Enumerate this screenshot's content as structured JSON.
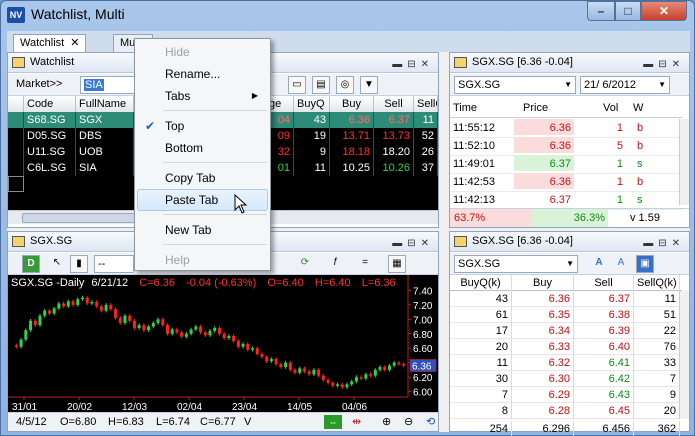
{
  "window": {
    "title": "Watchlist, Multi",
    "logo": "NV"
  },
  "tabs": [
    {
      "label": "Watchlist"
    },
    {
      "label": "Multi"
    }
  ],
  "watchlist": {
    "title": "Watchlist",
    "market_label": "Market>>",
    "market_value": "SIA",
    "columns": [
      "Code",
      "FullName",
      "ge",
      "BuyQ",
      "Buy",
      "Sell",
      "SellQ"
    ],
    "rows": [
      {
        "code": "S68.SG",
        "name": "SGX",
        "chg": "04",
        "buyq": "43",
        "buy": "6.36",
        "sell": "6.37",
        "sellq": "11",
        "selected": true
      },
      {
        "code": "D05.SG",
        "name": "DBS",
        "chg": "09",
        "buyq": "19",
        "buy": "13.71",
        "sell": "13.73",
        "sellq": "52"
      },
      {
        "code": "U11.SG",
        "name": "UOB",
        "chg": "32",
        "buyq": "9",
        "buy": "18.18",
        "sell": "18.20",
        "sellq": "26"
      },
      {
        "code": "C6L.SG",
        "name": "SIA",
        "chg": "01",
        "buyq": "11",
        "buy": "10.25",
        "sell": "10.26",
        "sellq": "37"
      }
    ]
  },
  "time_trades": {
    "title": "SGX.SG [6.36 -0.04]",
    "symbol": "SGX.SG",
    "date": "21/ 6/2012",
    "columns": [
      "Time",
      "Price",
      "Vol",
      "W"
    ],
    "rows": [
      {
        "time": "11:55:12",
        "price": "6.36",
        "vol": "1",
        "w": "b",
        "tone": "red"
      },
      {
        "time": "11:52:10",
        "price": "6.36",
        "vol": "5",
        "w": "b",
        "tone": "red"
      },
      {
        "time": "11:49:01",
        "price": "6.37",
        "vol": "1",
        "w": "s",
        "tone": "green"
      },
      {
        "time": "11:42:53",
        "price": "6.36",
        "vol": "1",
        "w": "b",
        "tone": "red"
      },
      {
        "time": "11:42:13",
        "price": "6.37",
        "vol": "1",
        "w": "s",
        "tone": "none"
      }
    ],
    "summary": {
      "buy_pct": "63.7%",
      "sell_pct": "36.3%",
      "vol": "v 1.59"
    }
  },
  "chart_panel": {
    "title": "SGX.SG",
    "select_placeholder": "-- Selec",
    "header": {
      "symbol": "SGX.SG -Daily",
      "date": "6/21/12",
      "close": "C=6.36",
      "change": "-0.04 (-0.63%)",
      "open": "O=6.40",
      "high": "H=6.40",
      "low": "L=6.36"
    },
    "last_price_tag": "6.36",
    "status": {
      "date": "4/5/12",
      "open": "O=6.80",
      "high": "H=6.83",
      "low": "L=6.74",
      "close": "C=6.77",
      "v": "V"
    }
  },
  "chart_data": {
    "type": "candlestick",
    "yticks": [
      "7.40",
      "7.20",
      "7.00",
      "6.80",
      "6.60",
      "6.40",
      "6.20",
      "6.00"
    ],
    "ylim": [
      5.98,
      7.42
    ],
    "xticks": [
      "31/01",
      "20/02",
      "12/03",
      "02/04",
      "23/04",
      "14/05",
      "04/06"
    ],
    "closes": [
      6.62,
      6.72,
      6.85,
      6.98,
      6.92,
      7.05,
      7.12,
      7.08,
      7.15,
      7.22,
      7.18,
      7.25,
      7.2,
      7.28,
      7.3,
      7.22,
      7.24,
      7.18,
      7.12,
      7.2,
      7.14,
      7.02,
      6.95,
      7.05,
      6.98,
      6.88,
      6.92,
      6.85,
      6.9,
      6.95,
      7.0,
      6.92,
      6.8,
      6.86,
      6.82,
      6.76,
      6.8,
      6.86,
      6.9,
      6.82,
      6.78,
      6.84,
      6.88,
      6.8,
      6.74,
      6.77,
      6.7,
      6.62,
      6.66,
      6.58,
      6.6,
      6.52,
      6.48,
      6.42,
      6.45,
      6.38,
      6.34,
      6.4,
      6.3,
      6.26,
      6.32,
      6.28,
      6.24,
      6.3,
      6.22,
      6.16,
      6.12,
      6.08,
      6.1,
      6.06,
      6.1,
      6.14,
      6.2,
      6.18,
      6.24,
      6.22,
      6.3,
      6.34,
      6.3,
      6.36,
      6.4,
      6.38,
      6.36
    ],
    "last": 6.36
  },
  "market_depth": {
    "title": "SGX.SG [6.36 -0.04]",
    "symbol": "SGX.SG",
    "columns": [
      "BuyQ(k)",
      "Buy",
      "Sell",
      "SellQ(k)"
    ],
    "rows": [
      [
        "43",
        "6.36",
        "6.37",
        "11"
      ],
      [
        "61",
        "6.35",
        "6.38",
        "51"
      ],
      [
        "17",
        "6.34",
        "6.39",
        "22"
      ],
      [
        "20",
        "6.33",
        "6.40",
        "76"
      ],
      [
        "11",
        "6.32",
        "6.41",
        "33"
      ],
      [
        "30",
        "6.30",
        "6.42",
        "7"
      ],
      [
        "7",
        "6.29",
        "6.43",
        "9"
      ],
      [
        "8",
        "6.28",
        "6.45",
        "20"
      ]
    ],
    "totals": [
      "254",
      "6.296",
      "6.456",
      "362"
    ]
  },
  "context_menu": {
    "items": [
      {
        "label": "Hide",
        "disabled": true
      },
      {
        "label": "Rename..."
      },
      {
        "label": "Tabs",
        "submenu": true
      },
      {
        "label": "Top",
        "checked": true
      },
      {
        "label": "Bottom"
      },
      {
        "label": "Copy Tab"
      },
      {
        "label": "Paste Tab",
        "hover": true
      },
      {
        "label": "New Tab"
      },
      {
        "label": "Help",
        "disabled": true
      }
    ]
  },
  "colors": {
    "accent": "#2c8c78",
    "up": "#2fd24a",
    "down": "#ff3030",
    "chart_bg": "#000000"
  }
}
